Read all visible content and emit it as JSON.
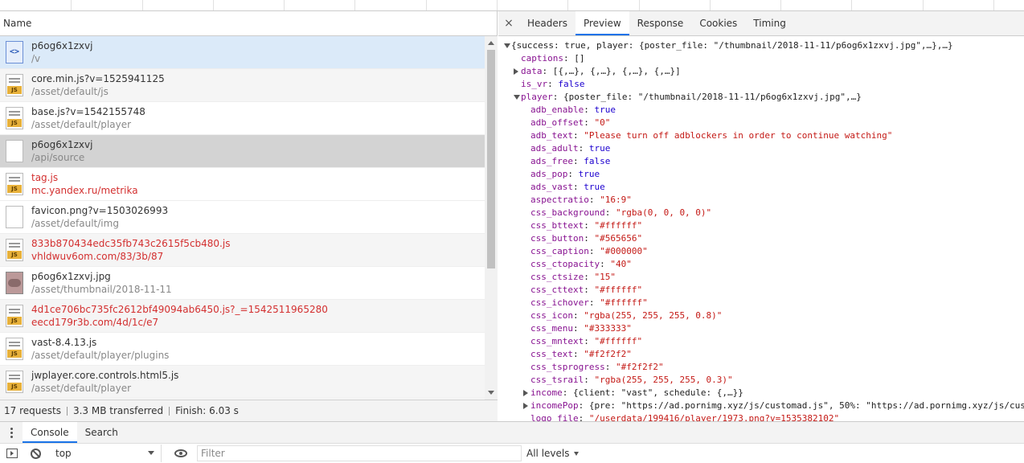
{
  "network": {
    "name_header": "Name",
    "requests": [
      {
        "name": "p6og6x1zxvj",
        "path": "/v",
        "icon": "html-doc-icon",
        "state": "selected"
      },
      {
        "name": "core.min.js?v=1525941125",
        "path": "/asset/default/js",
        "icon": "js-file-icon",
        "state": "alt"
      },
      {
        "name": "base.js?v=1542155748",
        "path": "/asset/default/player",
        "icon": "js-file-icon",
        "state": "normal"
      },
      {
        "name": "p6og6x1zxvj",
        "path": "/api/source",
        "icon": "document-icon",
        "state": "highlighted"
      },
      {
        "name": "tag.js",
        "path": "mc.yandex.ru/metrika",
        "icon": "js-file-icon",
        "state": "error"
      },
      {
        "name": "favicon.png?v=1503026993",
        "path": "/asset/default/img",
        "icon": "document-icon",
        "state": "normal"
      },
      {
        "name": "833b870434edc35fb743c2615f5cb480.js",
        "path": "vhldwuv6om.com/83/3b/87",
        "icon": "js-file-icon",
        "state": "error-alt"
      },
      {
        "name": "p6og6x1zxvj.jpg",
        "path": "/asset/thumbnail/2018-11-11",
        "icon": "image-thumbnail-icon",
        "state": "normal"
      },
      {
        "name": "4d1ce706bc735fc2612bf49094ab6450.js?_=1542511965280",
        "path": "eecd179r3b.com/4d/1c/e7",
        "icon": "js-file-icon",
        "state": "error-alt"
      },
      {
        "name": "vast-8.4.13.js",
        "path": "/asset/default/player/plugins",
        "icon": "js-file-icon",
        "state": "normal"
      },
      {
        "name": "jwplayer.core.controls.html5.js",
        "path": "/asset/default/player",
        "icon": "js-file-icon",
        "state": "alt"
      }
    ],
    "status": {
      "requests": "17 requests",
      "transferred": "3.3 MB transferred",
      "finish": "Finish: 6.03 s"
    }
  },
  "detail_tabs": {
    "close": "×",
    "items": [
      "Headers",
      "Preview",
      "Response",
      "Cookies",
      "Timing"
    ],
    "active": "Preview"
  },
  "preview_lines": [
    {
      "indent": 0,
      "arrow": "down",
      "segments": [
        {
          "c": "p",
          "t": "{success: true, player: {poster_file: \"/thumbnail/2018-11-11/p6og6x1zxvj.jpg\",…},…}"
        }
      ]
    },
    {
      "indent": 1,
      "arrow": "",
      "segments": [
        {
          "c": "k",
          "t": "captions"
        },
        {
          "c": "p",
          "t": ": []"
        }
      ]
    },
    {
      "indent": 1,
      "arrow": "right",
      "segments": [
        {
          "c": "k",
          "t": "data"
        },
        {
          "c": "p",
          "t": ": [{,…}, {,…}, {,…}, {,…}]"
        }
      ]
    },
    {
      "indent": 1,
      "arrow": "",
      "segments": [
        {
          "c": "k",
          "t": "is_vr"
        },
        {
          "c": "p",
          "t": ": "
        },
        {
          "c": "n",
          "t": "false"
        }
      ]
    },
    {
      "indent": 1,
      "arrow": "down",
      "segments": [
        {
          "c": "k",
          "t": "player"
        },
        {
          "c": "p",
          "t": ": {poster_file: \"/thumbnail/2018-11-11/p6og6x1zxvj.jpg\",…}"
        }
      ]
    },
    {
      "indent": 2,
      "arrow": "",
      "segments": [
        {
          "c": "k",
          "t": "adb_enable"
        },
        {
          "c": "p",
          "t": ": "
        },
        {
          "c": "n",
          "t": "true"
        }
      ]
    },
    {
      "indent": 2,
      "arrow": "",
      "segments": [
        {
          "c": "k",
          "t": "adb_offset"
        },
        {
          "c": "p",
          "t": ": "
        },
        {
          "c": "s",
          "t": "\"0\""
        }
      ]
    },
    {
      "indent": 2,
      "arrow": "",
      "segments": [
        {
          "c": "k",
          "t": "adb_text"
        },
        {
          "c": "p",
          "t": ": "
        },
        {
          "c": "s",
          "t": "\"Please turn off adblockers in order to continue watching\""
        }
      ]
    },
    {
      "indent": 2,
      "arrow": "",
      "segments": [
        {
          "c": "k",
          "t": "ads_adult"
        },
        {
          "c": "p",
          "t": ": "
        },
        {
          "c": "n",
          "t": "true"
        }
      ]
    },
    {
      "indent": 2,
      "arrow": "",
      "segments": [
        {
          "c": "k",
          "t": "ads_free"
        },
        {
          "c": "p",
          "t": ": "
        },
        {
          "c": "n",
          "t": "false"
        }
      ]
    },
    {
      "indent": 2,
      "arrow": "",
      "segments": [
        {
          "c": "k",
          "t": "ads_pop"
        },
        {
          "c": "p",
          "t": ": "
        },
        {
          "c": "n",
          "t": "true"
        }
      ]
    },
    {
      "indent": 2,
      "arrow": "",
      "segments": [
        {
          "c": "k",
          "t": "ads_vast"
        },
        {
          "c": "p",
          "t": ": "
        },
        {
          "c": "n",
          "t": "true"
        }
      ]
    },
    {
      "indent": 2,
      "arrow": "",
      "segments": [
        {
          "c": "k",
          "t": "aspectratio"
        },
        {
          "c": "p",
          "t": ": "
        },
        {
          "c": "s",
          "t": "\"16:9\""
        }
      ]
    },
    {
      "indent": 2,
      "arrow": "",
      "segments": [
        {
          "c": "k",
          "t": "css_background"
        },
        {
          "c": "p",
          "t": ": "
        },
        {
          "c": "s",
          "t": "\"rgba(0, 0, 0, 0)\""
        }
      ]
    },
    {
      "indent": 2,
      "arrow": "",
      "segments": [
        {
          "c": "k",
          "t": "css_bttext"
        },
        {
          "c": "p",
          "t": ": "
        },
        {
          "c": "s",
          "t": "\"#ffffff\""
        }
      ]
    },
    {
      "indent": 2,
      "arrow": "",
      "segments": [
        {
          "c": "k",
          "t": "css_button"
        },
        {
          "c": "p",
          "t": ": "
        },
        {
          "c": "s",
          "t": "\"#565656\""
        }
      ]
    },
    {
      "indent": 2,
      "arrow": "",
      "segments": [
        {
          "c": "k",
          "t": "css_caption"
        },
        {
          "c": "p",
          "t": ": "
        },
        {
          "c": "s",
          "t": "\"#000000\""
        }
      ]
    },
    {
      "indent": 2,
      "arrow": "",
      "segments": [
        {
          "c": "k",
          "t": "css_ctopacity"
        },
        {
          "c": "p",
          "t": ": "
        },
        {
          "c": "s",
          "t": "\"40\""
        }
      ]
    },
    {
      "indent": 2,
      "arrow": "",
      "segments": [
        {
          "c": "k",
          "t": "css_ctsize"
        },
        {
          "c": "p",
          "t": ": "
        },
        {
          "c": "s",
          "t": "\"15\""
        }
      ]
    },
    {
      "indent": 2,
      "arrow": "",
      "segments": [
        {
          "c": "k",
          "t": "css_cttext"
        },
        {
          "c": "p",
          "t": ": "
        },
        {
          "c": "s",
          "t": "\"#ffffff\""
        }
      ]
    },
    {
      "indent": 2,
      "arrow": "",
      "segments": [
        {
          "c": "k",
          "t": "css_ichover"
        },
        {
          "c": "p",
          "t": ": "
        },
        {
          "c": "s",
          "t": "\"#ffffff\""
        }
      ]
    },
    {
      "indent": 2,
      "arrow": "",
      "segments": [
        {
          "c": "k",
          "t": "css_icon"
        },
        {
          "c": "p",
          "t": ": "
        },
        {
          "c": "s",
          "t": "\"rgba(255, 255, 255, 0.8)\""
        }
      ]
    },
    {
      "indent": 2,
      "arrow": "",
      "segments": [
        {
          "c": "k",
          "t": "css_menu"
        },
        {
          "c": "p",
          "t": ": "
        },
        {
          "c": "s",
          "t": "\"#333333\""
        }
      ]
    },
    {
      "indent": 2,
      "arrow": "",
      "segments": [
        {
          "c": "k",
          "t": "css_mntext"
        },
        {
          "c": "p",
          "t": ": "
        },
        {
          "c": "s",
          "t": "\"#ffffff\""
        }
      ]
    },
    {
      "indent": 2,
      "arrow": "",
      "segments": [
        {
          "c": "k",
          "t": "css_text"
        },
        {
          "c": "p",
          "t": ": "
        },
        {
          "c": "s",
          "t": "\"#f2f2f2\""
        }
      ]
    },
    {
      "indent": 2,
      "arrow": "",
      "segments": [
        {
          "c": "k",
          "t": "css_tsprogress"
        },
        {
          "c": "p",
          "t": ": "
        },
        {
          "c": "s",
          "t": "\"#f2f2f2\""
        }
      ]
    },
    {
      "indent": 2,
      "arrow": "",
      "segments": [
        {
          "c": "k",
          "t": "css_tsrail"
        },
        {
          "c": "p",
          "t": ": "
        },
        {
          "c": "s",
          "t": "\"rgba(255, 255, 255, 0.3)\""
        }
      ]
    },
    {
      "indent": 2,
      "arrow": "right",
      "segments": [
        {
          "c": "k",
          "t": "income"
        },
        {
          "c": "p",
          "t": ": {client: \"vast\", schedule: {,…}}"
        }
      ]
    },
    {
      "indent": 2,
      "arrow": "right",
      "segments": [
        {
          "c": "k",
          "t": "incomePop"
        },
        {
          "c": "p",
          "t": ": {pre: \"https://ad.pornimg.xyz/js/customad.js\", 50%: \"https://ad.pornimg.xyz/js/cus"
        }
      ]
    },
    {
      "indent": 2,
      "arrow": "",
      "segments": [
        {
          "c": "k",
          "t": "logo_file"
        },
        {
          "c": "p",
          "t": ": "
        },
        {
          "c": "s",
          "t": "\"/userdata/199416/player/1973.png?v=1535382102\""
        }
      ]
    }
  ],
  "drawer": {
    "tabs": [
      "Console",
      "Search"
    ],
    "active_tab": "Console",
    "context": "top",
    "filter_placeholder": "Filter",
    "levels": "All levels"
  },
  "colors": {
    "selected_row": "#dbeaf9",
    "error_text": "#d32f2f",
    "json_key": "#881391",
    "json_string": "#c41a16",
    "json_literal": "#1c00cf",
    "active_tab_underline": "#1a73e8"
  }
}
